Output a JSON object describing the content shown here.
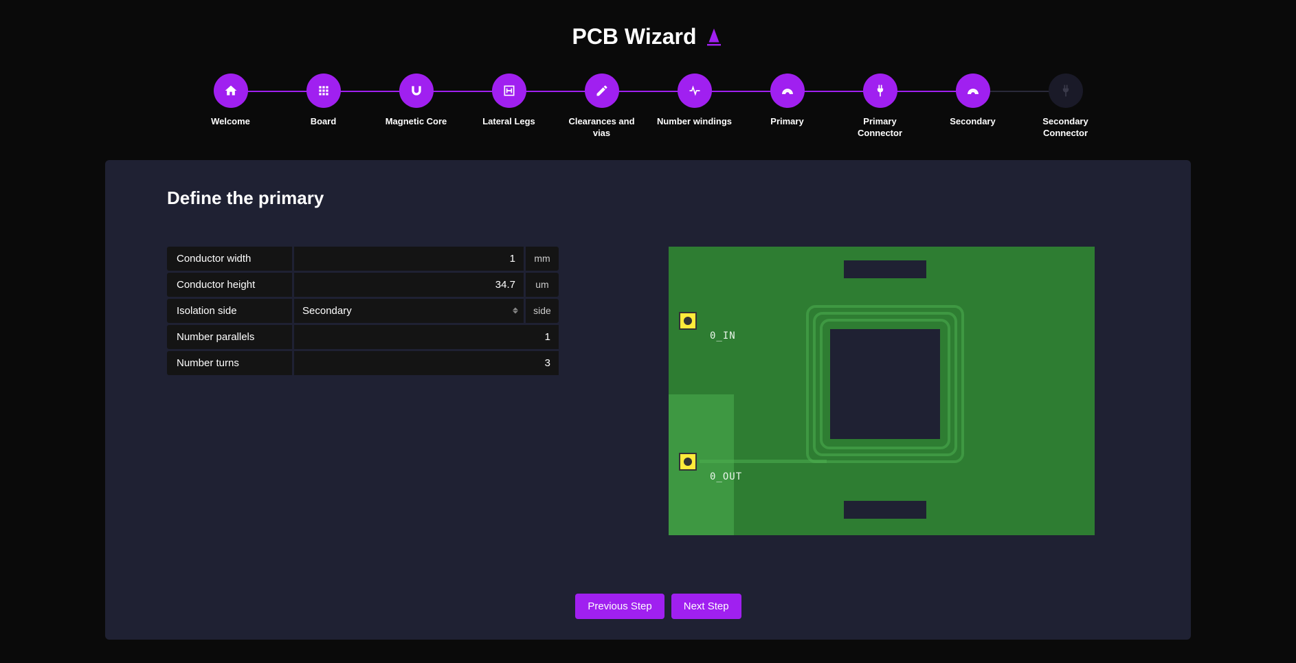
{
  "title": "PCB Wizard",
  "steps": [
    {
      "label": "Welcome",
      "icon": "home",
      "active": true
    },
    {
      "label": "Board",
      "icon": "grid",
      "active": true
    },
    {
      "label": "Magnetic Core",
      "icon": "magnet",
      "active": true
    },
    {
      "label": "Lateral Legs",
      "icon": "h-square",
      "active": true
    },
    {
      "label": "Clearances and vias",
      "icon": "pencil",
      "active": true
    },
    {
      "label": "Number windings",
      "icon": "pulse",
      "active": true
    },
    {
      "label": "Primary",
      "icon": "arc",
      "active": true
    },
    {
      "label": "Primary Connector",
      "icon": "plug",
      "active": true
    },
    {
      "label": "Secondary",
      "icon": "arc",
      "active": true
    },
    {
      "label": "Secondary Connector",
      "icon": "plug",
      "active": false
    }
  ],
  "panel": {
    "title": "Define the primary",
    "fields": {
      "conductor_width": {
        "label": "Conductor width",
        "value": "1",
        "unit": "mm"
      },
      "conductor_height": {
        "label": "Conductor height",
        "value": "34.7",
        "unit": "um"
      },
      "isolation_side": {
        "label": "Isolation side",
        "value": "Secondary",
        "unit": "side"
      },
      "number_parallels": {
        "label": "Number parallels",
        "value": "1"
      },
      "number_turns": {
        "label": "Number turns",
        "value": "3"
      }
    }
  },
  "pcb": {
    "label_in": "0_IN",
    "label_out": "0_OUT"
  },
  "buttons": {
    "prev": "Previous Step",
    "next": "Next Step"
  }
}
